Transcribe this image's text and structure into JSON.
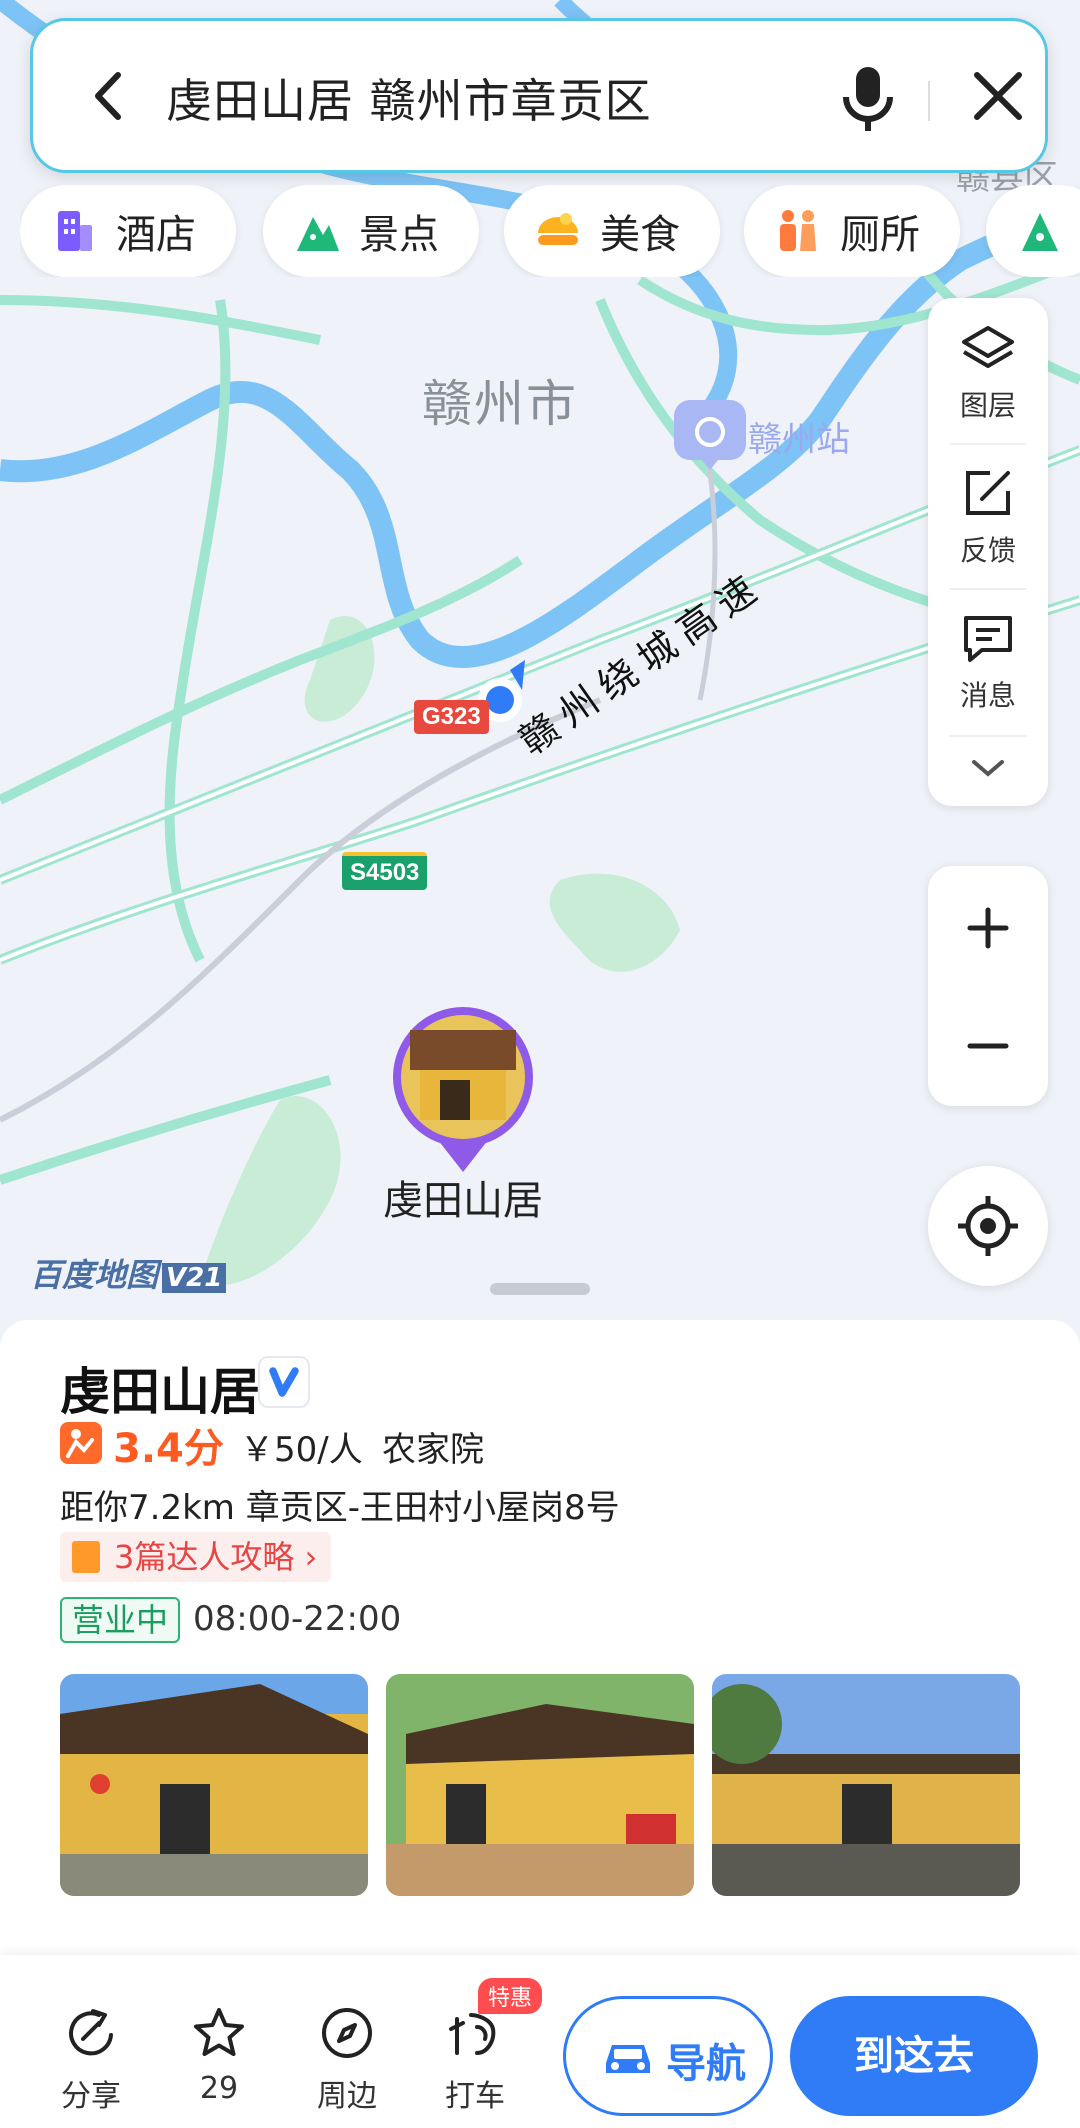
{
  "search": {
    "query": "虔田山居 赣州市章贡区"
  },
  "chips": [
    {
      "label": "酒店",
      "icon": "hotel-icon",
      "color": "#7a5cff"
    },
    {
      "label": "景点",
      "icon": "scenic-icon",
      "color": "#1fb87a"
    },
    {
      "label": "美食",
      "icon": "food-icon",
      "color": "#ffb21f"
    },
    {
      "label": "厕所",
      "icon": "toilet-icon",
      "color": "#ff7a3d"
    },
    {
      "label": "",
      "icon": "more-scenic-icon",
      "color": "#1fb87a"
    }
  ],
  "map": {
    "city_label": "赣州市",
    "station_label": "赣州站",
    "highway_label": "赣州绕城高速",
    "road_g": "G323",
    "road_s": "S4503",
    "poi_label": "虔田山居",
    "edge_label_top_right": "赣县区",
    "logo_text": "百度地图",
    "logo_version": "V21"
  },
  "tools": [
    {
      "label": "图层",
      "icon": "layers-icon"
    },
    {
      "label": "反馈",
      "icon": "feedback-icon"
    },
    {
      "label": "消息",
      "icon": "message-icon"
    }
  ],
  "place": {
    "name": "虔田山居",
    "rating": "3.4分",
    "price": "￥50/人",
    "category": "农家院",
    "distance_address": "距你7.2km  章贡区-王田村小屋岗8号",
    "guide": "3篇达人攻略",
    "status": "营业中",
    "hours": "08:00-22:00"
  },
  "bottom": {
    "share": "分享",
    "favorite_count": "29",
    "nearby": "周边",
    "taxi": "打车",
    "taxi_badge": "特惠",
    "navigate": "导航",
    "go_here": "到这去"
  }
}
